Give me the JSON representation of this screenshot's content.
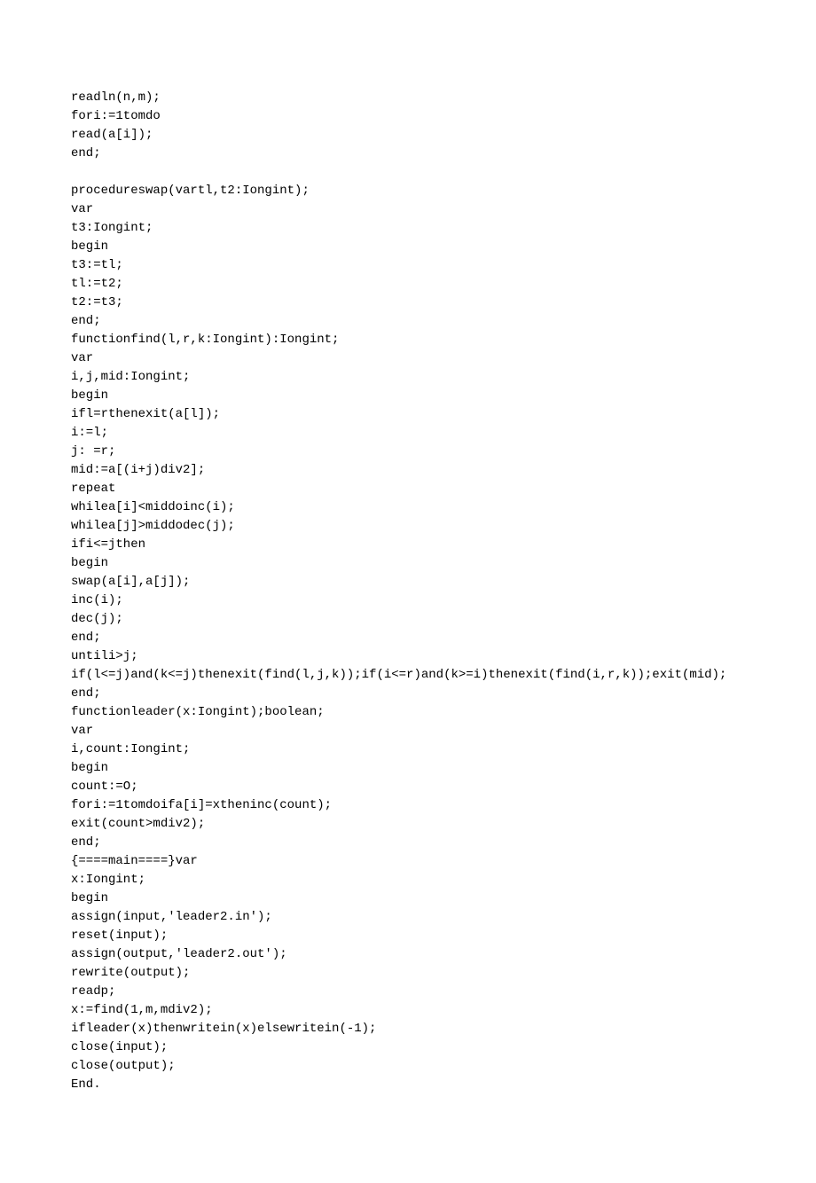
{
  "lines": [
    "readln(n,m);",
    "fori:=1tomdo",
    "read(a[i]);",
    "end;",
    "",
    "procedureswap(vartl,t2:Iongint);",
    "var",
    "t3:Iongint;",
    "begin",
    "t3:=tl;",
    "tl:=t2;",
    "t2:=t3;",
    "end;",
    "functionfind(l,r,k:Iongint):Iongint;",
    "var",
    "i,j,mid:Iongint;",
    "begin",
    "ifl=rthenexit(a[l]);",
    "i:=l;",
    "j: =r;",
    "mid:=a[(i+j)div2];",
    "repeat",
    "whilea[i]<middoinc(i);",
    "whilea[j]>middodec(j);",
    "ifi<=jthen",
    "begin",
    "swap(a[i],a[j]);",
    "inc(i);",
    "dec(j);",
    "end;",
    "untili>j;",
    "if(l<=j)and(k<=j)thenexit(find(l,j,k));if(i<=r)and(k>=i)thenexit(find(i,r,k));exit(mid);",
    "end;",
    "functionleader(x:Iongint);boolean;",
    "var",
    "i,count:Iongint;",
    "begin",
    "count:=O;",
    "fori:=1tomdoifa[i]=xtheninc(count);",
    "exit(count>mdiv2);",
    "end;",
    "{====main====}var",
    "x:Iongint;",
    "begin",
    "assign(input,'leader2.in');",
    "reset(input);",
    "assign(output,'leader2.out');",
    "rewrite(output);",
    "readp;",
    "x:=find(1,m,mdiv2);",
    "ifleader(x)thenwritein(x)elsewritein(-1);",
    "close(input);",
    "close(output);",
    "End."
  ]
}
